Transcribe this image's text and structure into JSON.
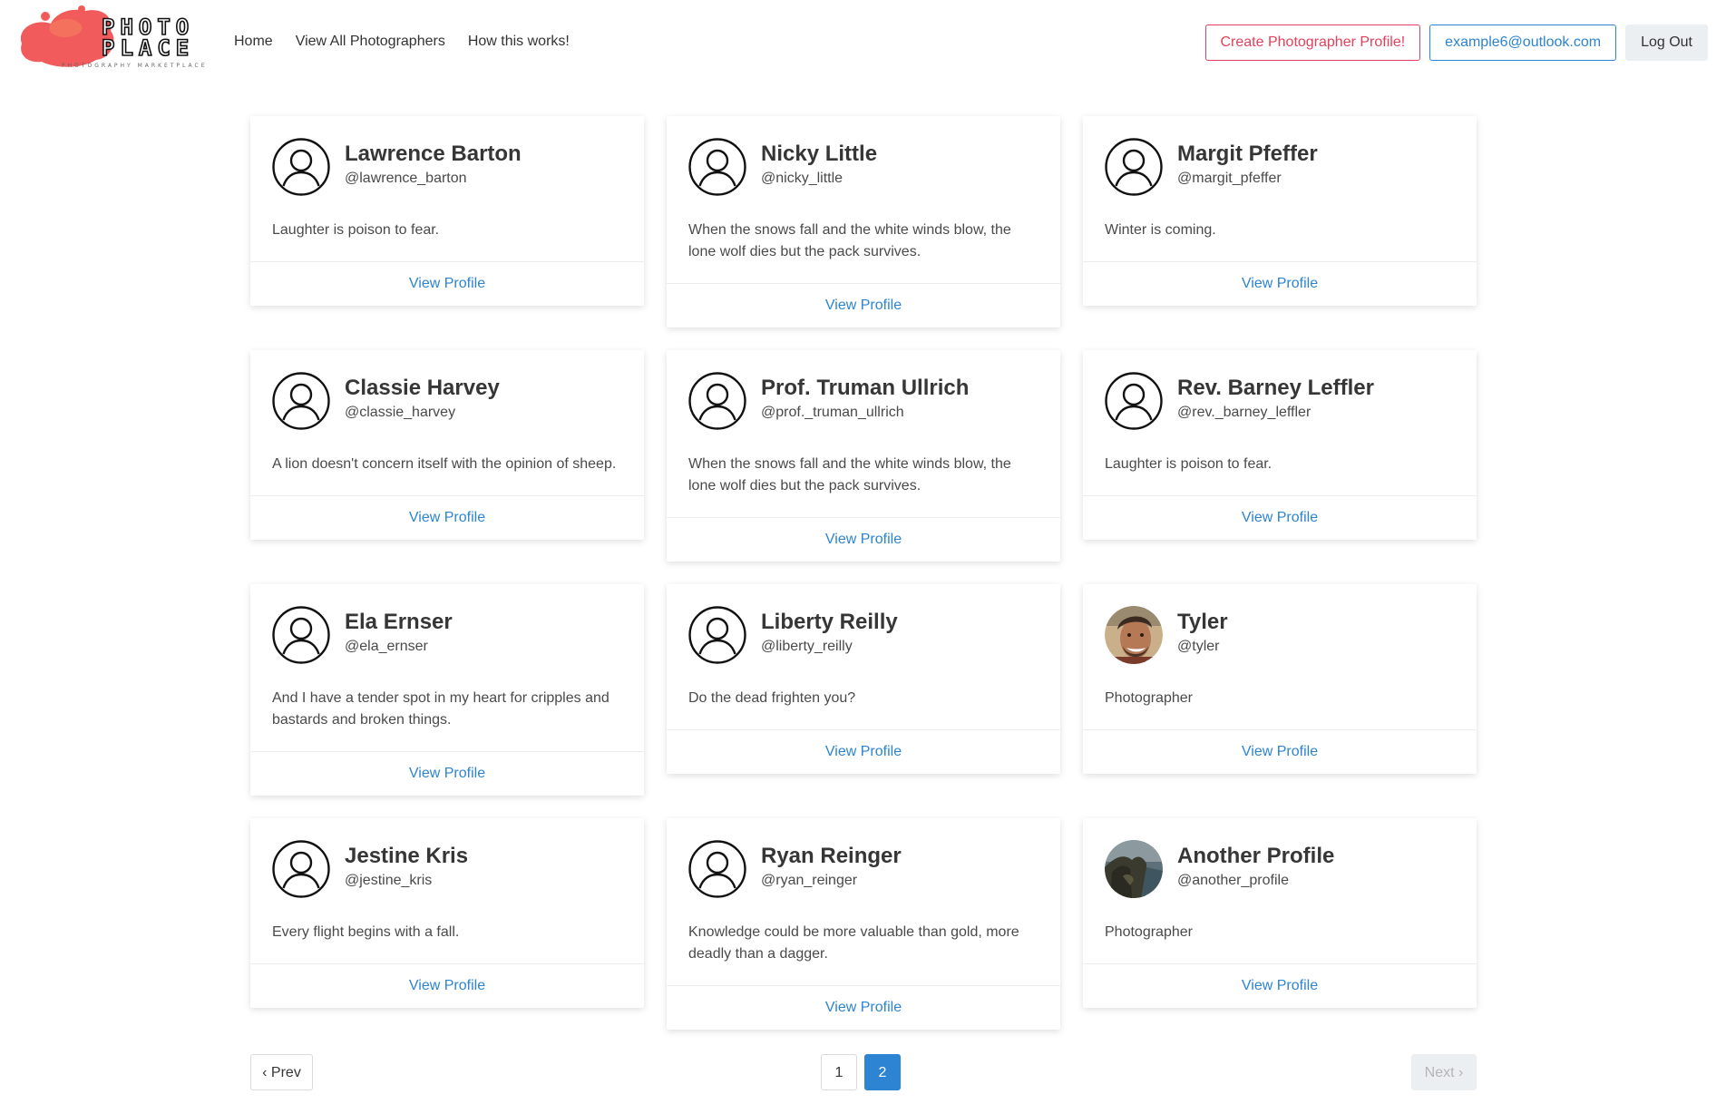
{
  "nav": {
    "logo_text_line1": "PHOTO",
    "logo_text_line2": "PLACE",
    "logo_tagline": "PHOTOGRAPHY MARKETPLACE",
    "links": [
      "Home",
      "View All Photographers",
      "How this works!"
    ],
    "create_profile_label": "Create Photographer Profile!",
    "account_email": "example6@outlook.com",
    "logout_label": "Log Out"
  },
  "colors": {
    "brand_pink": "#e2405c",
    "link_blue": "#2c84d2",
    "logo_blob": "#f25b5b"
  },
  "photographers": [
    {
      "name": "Lawrence Barton",
      "handle": "@lawrence_barton",
      "bio": "Laughter is poison to fear.",
      "avatar": "default-user-icon",
      "view_label": "View Profile"
    },
    {
      "name": "Nicky Little",
      "handle": "@nicky_little",
      "bio": "When the snows fall and the white winds blow, the lone wolf dies but the pack survives.",
      "avatar": "default-user-icon",
      "view_label": "View Profile"
    },
    {
      "name": "Margit Pfeffer",
      "handle": "@margit_pfeffer",
      "bio": "Winter is coming.",
      "avatar": "default-user-icon",
      "view_label": "View Profile"
    },
    {
      "name": "Classie Harvey",
      "handle": "@classie_harvey",
      "bio": "A lion doesn't concern itself with the opinion of sheep.",
      "avatar": "default-user-icon",
      "view_label": "View Profile"
    },
    {
      "name": "Prof. Truman Ullrich",
      "handle": "@prof._truman_ullrich",
      "bio": "When the snows fall and the white winds blow, the lone wolf dies but the pack survives.",
      "avatar": "default-user-icon",
      "view_label": "View Profile"
    },
    {
      "name": "Rev. Barney Leffler",
      "handle": "@rev._barney_leffler",
      "bio": "Laughter is poison to fear.",
      "avatar": "default-user-icon",
      "view_label": "View Profile"
    },
    {
      "name": "Ela Ernser",
      "handle": "@ela_ernser",
      "bio": "And I have a tender spot in my heart for cripples and bastards and broken things.",
      "avatar": "default-user-icon",
      "view_label": "View Profile"
    },
    {
      "name": "Liberty Reilly",
      "handle": "@liberty_reilly",
      "bio": "Do the dead frighten you?",
      "avatar": "default-user-icon",
      "view_label": "View Profile"
    },
    {
      "name": "Tyler",
      "handle": "@tyler",
      "bio": "Photographer",
      "avatar": "face-photo",
      "view_label": "View Profile"
    },
    {
      "name": "Jestine Kris",
      "handle": "@jestine_kris",
      "bio": "Every flight begins with a fall.",
      "avatar": "default-user-icon",
      "view_label": "View Profile"
    },
    {
      "name": "Ryan Reinger",
      "handle": "@ryan_reinger",
      "bio": "Knowledge could be more valuable than gold, more deadly than a dagger.",
      "avatar": "default-user-icon",
      "view_label": "View Profile"
    },
    {
      "name": "Another Profile",
      "handle": "@another_profile",
      "bio": "Photographer",
      "avatar": "landscape-photo",
      "view_label": "View Profile"
    }
  ],
  "pagination": {
    "prev_label": "‹ Prev",
    "pages": [
      "1",
      "2"
    ],
    "current_page": "2",
    "next_label": "Next ›"
  }
}
